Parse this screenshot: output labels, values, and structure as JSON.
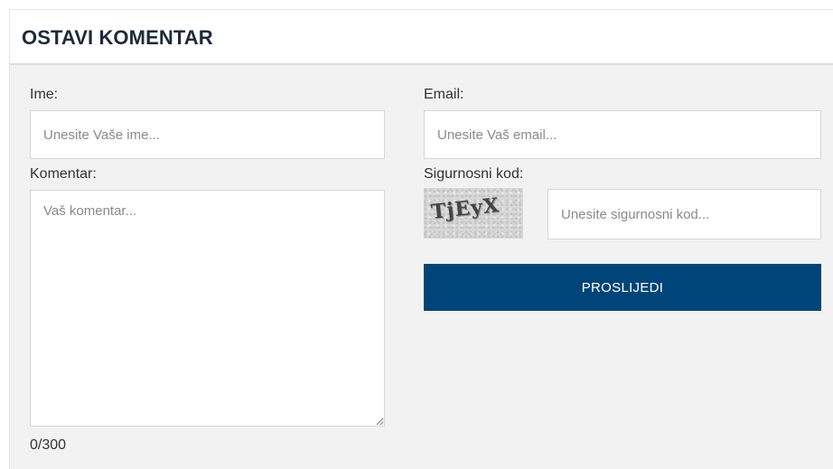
{
  "form": {
    "title": "OSTAVI KOMENTAR",
    "name": {
      "label": "Ime:",
      "placeholder": "Unesite Vaše ime..."
    },
    "email": {
      "label": "Email:",
      "placeholder": "Unesite Vaš email..."
    },
    "comment": {
      "label": "Komentar:",
      "placeholder": "Vaš komentar...",
      "counter": "0/300"
    },
    "captcha": {
      "label": "Sigurnosni kod:",
      "image_text": "TjEyX",
      "placeholder": "Unesite sigurnosni kod..."
    },
    "submit_label": "PROSLIJEDI"
  },
  "colors": {
    "panel_background": "#f2f2f2",
    "header_background": "#ffffff",
    "submit_background": "#00457a",
    "submit_text": "#ffffff"
  }
}
